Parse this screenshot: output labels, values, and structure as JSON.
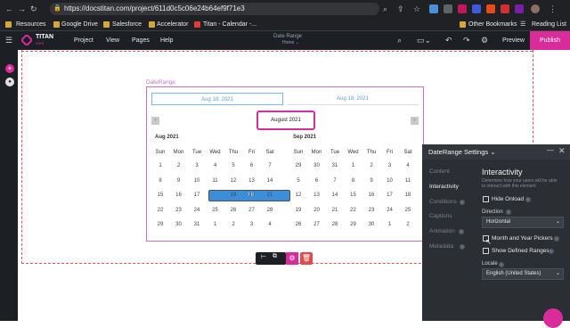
{
  "browser": {
    "url": "https://docstitan.com/project/611d0c5c06e24b64ef9f71e3",
    "bookmarks": [
      "Resources",
      "Google Drive",
      "Salesforce",
      "Accelerator",
      "Titan - Calendar -..."
    ],
    "other_bookmarks": "Other Bookmarks",
    "reading_list": "Reading List"
  },
  "app": {
    "logo_text": "TITAN",
    "logo_sub": "WEB",
    "menu": [
      "Project",
      "View",
      "Pages",
      "Help"
    ],
    "page_title": "Date Range",
    "page_sub": "Home",
    "preview_label": "Preview",
    "publish_label": "Publish"
  },
  "component": {
    "label": "DateRange",
    "start_value": "Aug 18, 2021",
    "end_value": "Aug 18, 2021",
    "month_button": "August 2021",
    "months": [
      {
        "label": "Aug 2021",
        "weekdays": [
          "Sun",
          "Mon",
          "Tue",
          "Wed",
          "Thu",
          "Fri",
          "Sat"
        ],
        "rows": [
          [
            "1",
            "2",
            "3",
            "4",
            "5",
            "6",
            "7"
          ],
          [
            "8",
            "9",
            "10",
            "11",
            "12",
            "13",
            "14"
          ],
          [
            "15",
            "16",
            "17",
            "18",
            "19",
            "20",
            "21"
          ],
          [
            "22",
            "23",
            "24",
            "25",
            "26",
            "27",
            "28"
          ],
          [
            "29",
            "30",
            "31",
            "1",
            "2",
            "3",
            "4"
          ]
        ],
        "selected": "18"
      },
      {
        "label": "Sep 2021",
        "weekdays": [
          "Sun",
          "Mon",
          "Tue",
          "Wed",
          "Thu",
          "Fri",
          "Sat"
        ],
        "rows": [
          [
            "29",
            "30",
            "31",
            "1",
            "2",
            "3",
            "4"
          ],
          [
            "5",
            "6",
            "7",
            "8",
            "9",
            "10",
            "11"
          ],
          [
            "12",
            "13",
            "14",
            "15",
            "16",
            "17",
            "18"
          ],
          [
            "19",
            "20",
            "21",
            "22",
            "23",
            "24",
            "25"
          ],
          [
            "26",
            "27",
            "28",
            "29",
            "30",
            "1",
            "2"
          ]
        ]
      }
    ]
  },
  "panel": {
    "title": "DateRange Settings",
    "tabs": [
      "Content",
      "Interactivity",
      "Conditions",
      "Captions",
      "Animation",
      "Metadata"
    ],
    "active_tab": "Interactivity",
    "section_title": "Interactivity",
    "section_desc": "Determine how your users will be able to interact with this element",
    "hide_onload": "Hide Onload",
    "direction_label": "Direction",
    "direction_value": "Horizontal",
    "month_year_pickers": "Month and Year Pickers",
    "show_defined_ranges": "Show Defined Ranges",
    "locale_label": "Locale",
    "locale_value": "English (United States)"
  },
  "colors": {
    "accent": "#d92c9a",
    "selected_day": "#3b8fd9",
    "input_text": "#5b9fd6"
  }
}
